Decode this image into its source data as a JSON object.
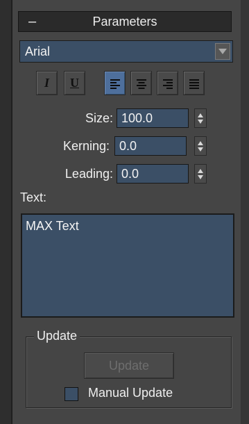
{
  "rollout": {
    "collapse_symbol": "–",
    "title": "Parameters"
  },
  "font": {
    "selected": "Arial",
    "dropdown_icon": "chevron-down-icon"
  },
  "format_buttons": [
    {
      "name": "italic",
      "label": "I",
      "active": false
    },
    {
      "name": "underline",
      "label": "U",
      "active": false
    },
    {
      "name": "align-left",
      "icon": "align-left-icon",
      "active": true
    },
    {
      "name": "align-center",
      "icon": "align-center-icon",
      "active": false
    },
    {
      "name": "align-right",
      "icon": "align-right-icon",
      "active": false
    },
    {
      "name": "justify",
      "icon": "justify-icon",
      "active": false
    }
  ],
  "size": {
    "label": "Size:",
    "value": "100.0"
  },
  "kerning": {
    "label": "Kerning:",
    "value": "0.0"
  },
  "leading": {
    "label": "Leading:",
    "value": "0.0"
  },
  "text": {
    "label": "Text:",
    "content": "MAX Text"
  },
  "update_group": {
    "legend": "Update",
    "button_label": "Update",
    "button_enabled": false,
    "manual_update_label": "Manual Update",
    "manual_update_checked": false
  },
  "colors": {
    "panel": "#454545",
    "field": "#3b4f66",
    "active_button": "#4e6f9c"
  }
}
